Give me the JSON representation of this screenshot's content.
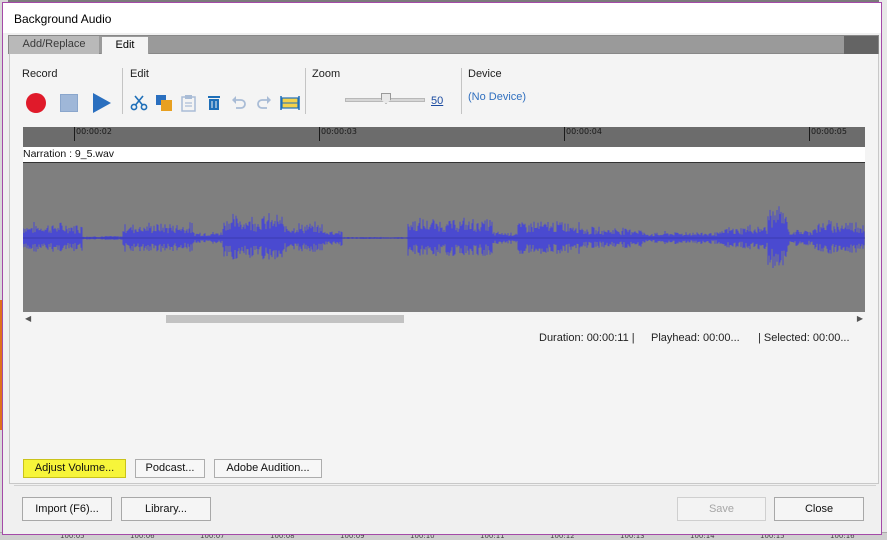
{
  "window": {
    "title": "Background Audio"
  },
  "tabs": [
    {
      "label": "Add/Replace",
      "active": false
    },
    {
      "label": "Edit",
      "active": true
    }
  ],
  "toolbar": {
    "record_label": "Record",
    "edit_label": "Edit",
    "zoom_label": "Zoom",
    "device_label": "Device",
    "zoom_value": "50",
    "zoom_level": 0.5,
    "device_value": "(No Device)"
  },
  "timeline": {
    "ruler_ticks": [
      "00:00:02",
      "00:00:03",
      "00:00:04",
      "00:00:05"
    ],
    "track_name": "Narration : 9_5.wav"
  },
  "status": {
    "duration": "Duration:  00:00:11  |",
    "playhead": "Playhead:  00:00...",
    "selected": "|  Selected:  00:00..."
  },
  "buttons": {
    "adjust_volume": "Adjust Volume...",
    "podcast": "Podcast...",
    "adobe_audition": "Adobe Audition...",
    "import": "Import (F6)...",
    "library": "Library...",
    "save": "Save",
    "close": "Close"
  },
  "background_ticks": [
    "100:05",
    "100:06",
    "100:07",
    "100:08",
    "100:09",
    "100:10",
    "100:11",
    "100:12",
    "100:13",
    "100:14",
    "100:15",
    "100:16"
  ],
  "colors": {
    "record": "#e01a2a",
    "play": "#2a6fbf",
    "waveform": "#4a4ad0",
    "highlight": "#f7f53a",
    "window_border": "#a44aa8"
  },
  "icons": {
    "cut": "scissors-icon",
    "copy": "copy-icon",
    "paste": "paste-icon",
    "delete": "trash-icon",
    "undo": "undo-icon",
    "redo": "redo-icon",
    "insert_silence": "insert-silence-icon"
  }
}
